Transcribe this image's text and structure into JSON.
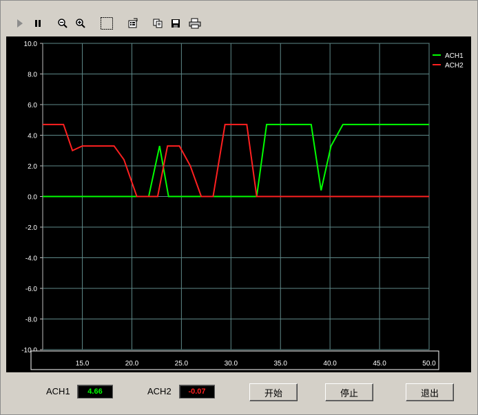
{
  "toolbar": {
    "buttons": [
      {
        "name": "play-icon"
      },
      {
        "name": "pause-icon"
      },
      {
        "name": "zoom-out-icon"
      },
      {
        "name": "zoom-in-icon"
      },
      {
        "name": "select-region-icon"
      },
      {
        "name": "properties-icon"
      },
      {
        "name": "copy-icon"
      },
      {
        "name": "save-icon"
      },
      {
        "name": "print-icon"
      }
    ]
  },
  "status": {
    "ach1_label": "ACH1",
    "ach1_value": "4.66",
    "ach2_label": "ACH2",
    "ach2_value": "-0.07",
    "ach1_color": "#00ff00",
    "ach2_color": "#ff2020"
  },
  "buttons": {
    "start": "开始",
    "stop": "停止",
    "exit": "退出"
  },
  "chart_data": {
    "type": "line",
    "background": "#000000",
    "grid": true,
    "xlim": [
      11.0,
      50.0
    ],
    "ylim": [
      -10.0,
      10.0
    ],
    "xticks": [
      "15.0",
      "20.0",
      "25.0",
      "30.0",
      "35.0",
      "40.0",
      "45.0",
      "50.0"
    ],
    "yticks": [
      "10.0",
      "8.0",
      "6.0",
      "4.0",
      "2.0",
      "0.0",
      "-2.0",
      "-4.0",
      "-6.0",
      "-8.0",
      "-10.0"
    ],
    "legend_position": "top-right",
    "series": [
      {
        "name": "ACH1",
        "color": "#00ff00",
        "x": [
          11.0,
          21.7,
          22.8,
          23.7,
          32.6,
          33.6,
          38.1,
          39.1,
          40.1,
          41.3,
          50.0
        ],
        "y": [
          0.0,
          0.0,
          3.3,
          0.0,
          0.0,
          4.7,
          4.7,
          0.4,
          3.3,
          4.7,
          4.7
        ]
      },
      {
        "name": "ACH2",
        "color": "#ff2020",
        "x": [
          11.0,
          13.1,
          14.0,
          15.0,
          18.2,
          19.2,
          20.5,
          21.7,
          22.6,
          23.6,
          24.8,
          25.9,
          27.0,
          28.2,
          29.4,
          31.6,
          32.6,
          50.0
        ],
        "y": [
          4.7,
          4.7,
          3.0,
          3.3,
          3.3,
          2.4,
          0.0,
          0.0,
          0.0,
          3.3,
          3.3,
          2.0,
          0.0,
          0.0,
          4.7,
          4.7,
          0.0,
          0.0
        ]
      }
    ]
  }
}
